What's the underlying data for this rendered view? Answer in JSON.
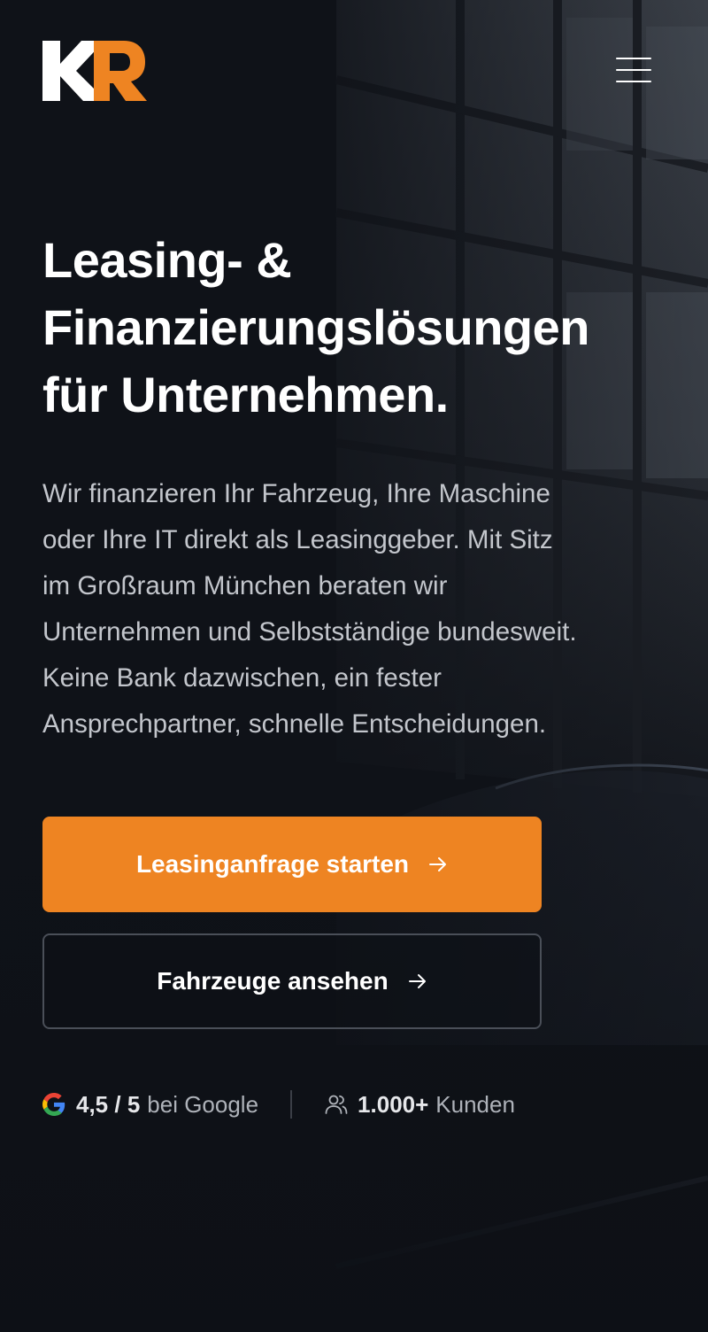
{
  "brand": {
    "logo_text": "KR",
    "accent_color": "#ee8422"
  },
  "nav": {
    "menu_icon": "hamburger-menu-icon"
  },
  "hero": {
    "headline_line1": "Leasing- &",
    "headline_line2": "Finanzierungslösungen",
    "headline_line3": "für Unternehmen.",
    "lead_line1": "Wir finanzieren Ihr Fahrzeug, Ihre Maschine",
    "lead_line2": "oder Ihre IT direkt als Leasinggeber. Mit Sitz",
    "lead_line3": "im Großraum München beraten wir",
    "lead_line4": "Unternehmen und Selbstständige bundesweit.",
    "lead_line5": "Keine Bank dazwischen, ein fester",
    "lead_line6": "Ansprechpartner, schnelle Entscheidungen."
  },
  "actions": {
    "primary_label": "Leasinganfrage starten",
    "secondary_label": "Fahrzeuge ansehen",
    "arrow_icon": "arrow-right-icon"
  },
  "trust": {
    "rating_value": "4,5 / 5",
    "rating_source": "bei Google",
    "rating_icon": "google-icon",
    "customers_value": "1.000+",
    "customers_label": "Kunden",
    "customers_icon": "users-icon"
  }
}
